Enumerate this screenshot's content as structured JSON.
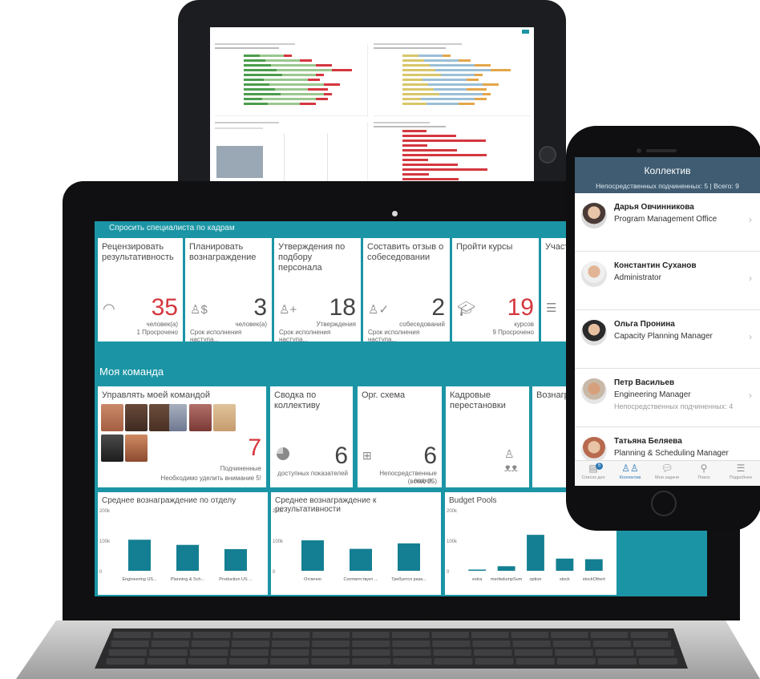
{
  "colors": {
    "teal": "#1b95a5",
    "bar": "#147f92",
    "red": "#d4373f",
    "phone_header": "#3f5c72",
    "phone_active": "#2f79b6"
  },
  "laptop": {
    "topbar_title": "Спросить специалиста по кадрам",
    "tiles_row1": [
      {
        "title": "Рецензировать результативность",
        "value": "35",
        "sub": "человек(а)",
        "foot": "1 Просрочено",
        "icon": "gauge-icon",
        "value_color": "#d4373f"
      },
      {
        "title": "Планировать вознаграждение",
        "value": "3",
        "sub": "человек(а)",
        "foot": "Срок исполнения наступа...",
        "icon": "person-dollar-icon",
        "value_color": "#444444"
      },
      {
        "title": "Утверждения по подбору персонала",
        "value": "18",
        "sub": "Утверждения",
        "foot": "Срок исполнения наступа...",
        "icon": "person-add-icon",
        "value_color": "#444444"
      },
      {
        "title": "Составить отзыв о собеседовании",
        "value": "2",
        "sub": "собеседований",
        "foot": "Срок исполнения наступа...",
        "icon": "person-check-icon",
        "value_color": "#444444"
      },
      {
        "title": "Пройти курсы",
        "value": "19",
        "sub": "курсов",
        "foot": "9 Просрочено",
        "icon": "graduation-cap-icon",
        "value_color": "#d4373f"
      },
      {
        "title": "Участво",
        "value": "",
        "sub": "",
        "foot": "",
        "icon": "checklist-icon",
        "value_color": "#444444"
      }
    ],
    "section_title": "Моя команда",
    "tiles_row2": [
      {
        "title": "Управлять моей командой",
        "value": "7",
        "sub": "Подчиненные",
        "foot": "Необходимо уделить внимание 5!"
      },
      {
        "title": "Сводка по коллективу",
        "value": "6",
        "sub": "доступных показателей"
      },
      {
        "title": "Орг. схема",
        "value": "6",
        "sub": "Непосредственные подчи...",
        "sub2": "(всего 25)"
      },
      {
        "title": "Кадровые перестановки",
        "value": "",
        "sub": ""
      },
      {
        "title": "Вознагр",
        "value": "",
        "sub": ""
      }
    ]
  },
  "chart_data": [
    {
      "type": "bar",
      "title": "Среднее вознаграждение по отделу",
      "categories": [
        "Engineering US...",
        "Planning & Sch...",
        "Production US ..."
      ],
      "values": [
        102000,
        85000,
        71000
      ],
      "yticks": [
        "200k",
        "100k",
        "0"
      ],
      "ylim": [
        0,
        200000
      ]
    },
    {
      "type": "bar",
      "title": "Среднее вознаграждение к результативности",
      "categories": [
        "Отлично",
        "Соответствует ...",
        "Требуется раза..."
      ],
      "values": [
        100000,
        72000,
        90000
      ],
      "yticks": [
        "200k",
        "100k",
        "0"
      ],
      "ylim": [
        0,
        200000
      ]
    },
    {
      "type": "bar",
      "title": "Budget Pools",
      "categories": [
        "extra",
        "meritwlumpSum",
        "option",
        "stock",
        "stockOthert"
      ],
      "values": [
        4000,
        15000,
        118000,
        40000,
        38000
      ],
      "yticks": [
        "200k",
        "100k",
        "0"
      ],
      "ylim": [
        0,
        200000
      ]
    }
  ],
  "phone": {
    "title": "Коллектив",
    "subtitle": "Непосредственных подчиненных: 5 | Всего: 9",
    "people": [
      {
        "name": "Дарья Овчинникова",
        "role": "Program Management Office",
        "extra": ""
      },
      {
        "name": "Константин Суханов",
        "role": "Administrator",
        "extra": ""
      },
      {
        "name": "Ольга Пронина",
        "role": "Capacity Planning Manager",
        "extra": ""
      },
      {
        "name": "Петр Васильев",
        "role": "Engineering Manager",
        "extra": "Непосредственных подчиненных: 4"
      },
      {
        "name": "Татьяна Беляева",
        "role": "Planning & Scheduling Manager",
        "extra": ""
      }
    ],
    "tabs": [
      {
        "label": "Список дел",
        "icon": "todo-list-icon",
        "badge": "5"
      },
      {
        "label": "Коллектив",
        "icon": "people-icon"
      },
      {
        "label": "Мои задачи",
        "icon": "chat-icon"
      },
      {
        "label": "Поиск",
        "icon": "search-icon"
      },
      {
        "label": "Подробнее",
        "icon": "more-list-icon"
      }
    ]
  }
}
